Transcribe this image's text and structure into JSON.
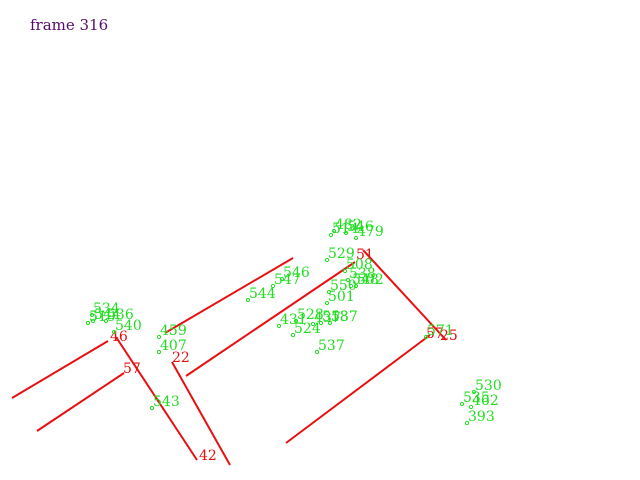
{
  "frame_label": "frame 316",
  "colors": {
    "segment": "#e81010",
    "segment_label": "#e01010",
    "point": "#22dd22",
    "title": "#5a0a6e"
  },
  "segments": [
    {
      "id": "46"
    },
    {
      "id": "57"
    },
    {
      "id": "42"
    },
    {
      "id": "22"
    },
    {
      "id": "51"
    },
    {
      "id": "25"
    },
    {
      "id": "57"
    }
  ],
  "points": [
    {
      "id": "534"
    },
    {
      "id": "519"
    },
    {
      "id": "544"
    },
    {
      "id": "536"
    },
    {
      "id": "540"
    },
    {
      "id": "459"
    },
    {
      "id": "407"
    },
    {
      "id": "543"
    },
    {
      "id": "546"
    },
    {
      "id": "547"
    },
    {
      "id": "544"
    },
    {
      "id": "482"
    },
    {
      "id": "514"
    },
    {
      "id": "546"
    },
    {
      "id": "479"
    },
    {
      "id": "529"
    },
    {
      "id": "508"
    },
    {
      "id": "538"
    },
    {
      "id": "548"
    },
    {
      "id": "502"
    },
    {
      "id": "550"
    },
    {
      "id": "501"
    },
    {
      "id": "537"
    },
    {
      "id": "431"
    },
    {
      "id": "528"
    },
    {
      "id": "518"
    },
    {
      "id": "524"
    },
    {
      "id": "437"
    },
    {
      "id": "537"
    },
    {
      "id": "571"
    },
    {
      "id": "530"
    },
    {
      "id": "535"
    },
    {
      "id": "462"
    },
    {
      "id": "393"
    }
  ]
}
